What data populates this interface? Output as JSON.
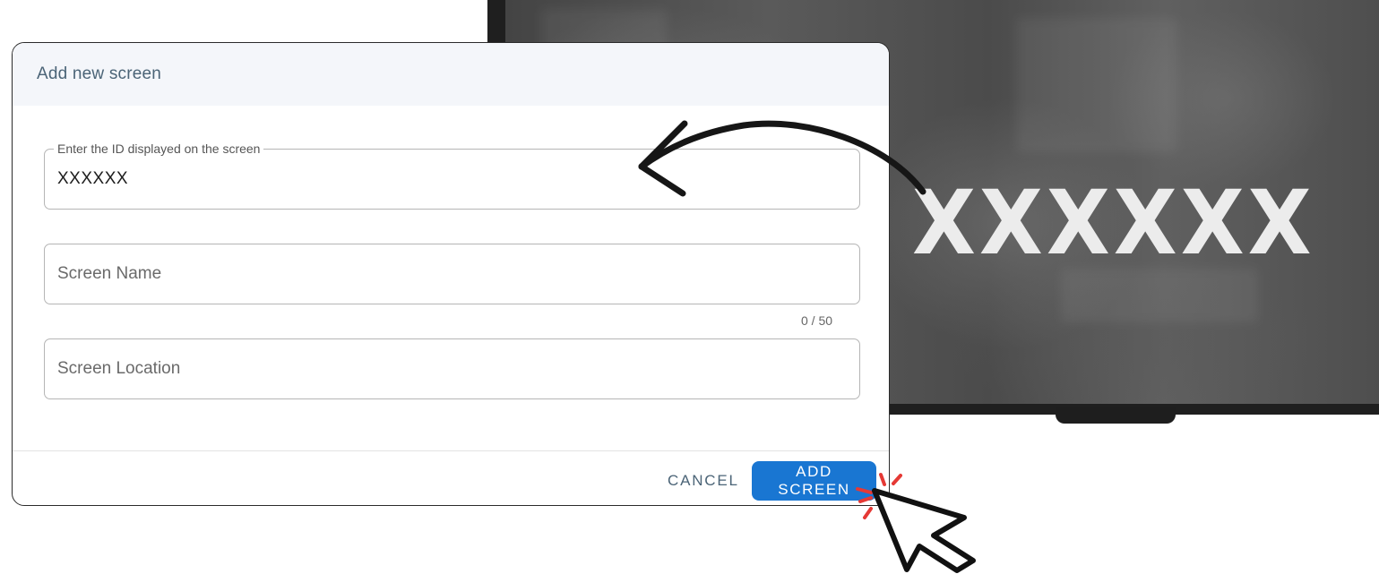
{
  "dialog": {
    "title": "Add new screen",
    "fields": {
      "screen_id": {
        "label": "Enter the ID displayed on the screen",
        "value": "XXXXXX"
      },
      "screen_name": {
        "placeholder": "Screen Name",
        "counter": "0 / 50"
      },
      "screen_location": {
        "placeholder": "Screen Location"
      }
    },
    "actions": {
      "cancel_label": "CANCEL",
      "add_label": "ADD SCREEN"
    }
  },
  "display": {
    "screen_id": "XXXXXX"
  },
  "colors": {
    "primary": "#1976d2",
    "title_text": "#4b6477",
    "header_bg": "#f4f6fa",
    "click_marks": "#e53935"
  },
  "icons": {
    "arrow": "curved-arrow-icon",
    "cursor": "mouse-pointer-icon",
    "click": "click-burst-icon"
  }
}
